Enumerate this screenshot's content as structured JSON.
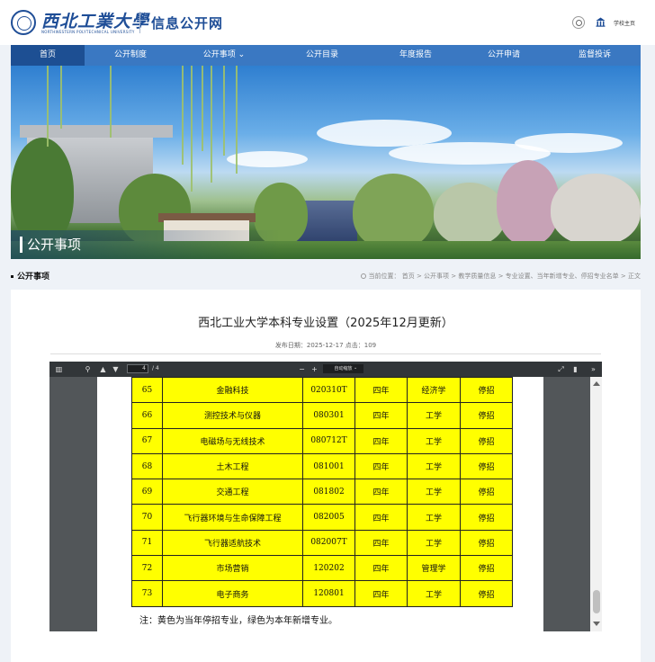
{
  "header": {
    "logo_text": "西北工業大學",
    "logo_en": "NORTHWESTERN POLYTECHNICAL UNIVERSITY",
    "site_title": "信息公开网",
    "home_link": "学校主页"
  },
  "nav": {
    "items": [
      {
        "label": "首页"
      },
      {
        "label": "公开制度"
      },
      {
        "label": "公开事项 ⌄"
      },
      {
        "label": "公开目录"
      },
      {
        "label": "年度报告"
      },
      {
        "label": "公开申请"
      },
      {
        "label": "监督投诉"
      }
    ]
  },
  "banner": {
    "title": "公开事项"
  },
  "section": {
    "title": "公开事项",
    "breadcrumb": "当前位置： 首页 > 公开事项 > 教学质量信息 > 专业设置、当年新增专业、停招专业名单 > 正文"
  },
  "article": {
    "title": "西北工业大学本科专业设置（2025年12月更新）",
    "meta": "发布日期：2025-12-17    点击：109"
  },
  "pdf_viewer": {
    "page_input": "4",
    "page_total": "/ 4",
    "zoom_label": "自动缩放",
    "zoom_caret": "⌄",
    "table_rows": [
      {
        "no": "65",
        "name": "金融科技",
        "code": "020310T",
        "years": "四年",
        "category": "经济学",
        "status": "停招"
      },
      {
        "no": "66",
        "name": "测控技术与仪器",
        "code": "080301",
        "years": "四年",
        "category": "工学",
        "status": "停招"
      },
      {
        "no": "67",
        "name": "电磁场与无线技术",
        "code": "080712T",
        "years": "四年",
        "category": "工学",
        "status": "停招"
      },
      {
        "no": "68",
        "name": "土木工程",
        "code": "081001",
        "years": "四年",
        "category": "工学",
        "status": "停招"
      },
      {
        "no": "69",
        "name": "交通工程",
        "code": "081802",
        "years": "四年",
        "category": "工学",
        "status": "停招"
      },
      {
        "no": "70",
        "name": "飞行器环境与生命保障工程",
        "code": "082005",
        "years": "四年",
        "category": "工学",
        "status": "停招"
      },
      {
        "no": "71",
        "name": "飞行器适航技术",
        "code": "082007T",
        "years": "四年",
        "category": "工学",
        "status": "停招"
      },
      {
        "no": "72",
        "name": "市场营销",
        "code": "120202",
        "years": "四年",
        "category": "管理学",
        "status": "停招"
      },
      {
        "no": "73",
        "name": "电子商务",
        "code": "120801",
        "years": "四年",
        "category": "工学",
        "status": "停招"
      }
    ],
    "note": "注：黄色为当年停招专业，绿色为本年新增专业。"
  },
  "colors": {
    "nav_bg": "#3a78c2",
    "nav_active": "#1d4f93",
    "brand_blue": "#1f4e97",
    "row_highlight": "#ffff00"
  }
}
